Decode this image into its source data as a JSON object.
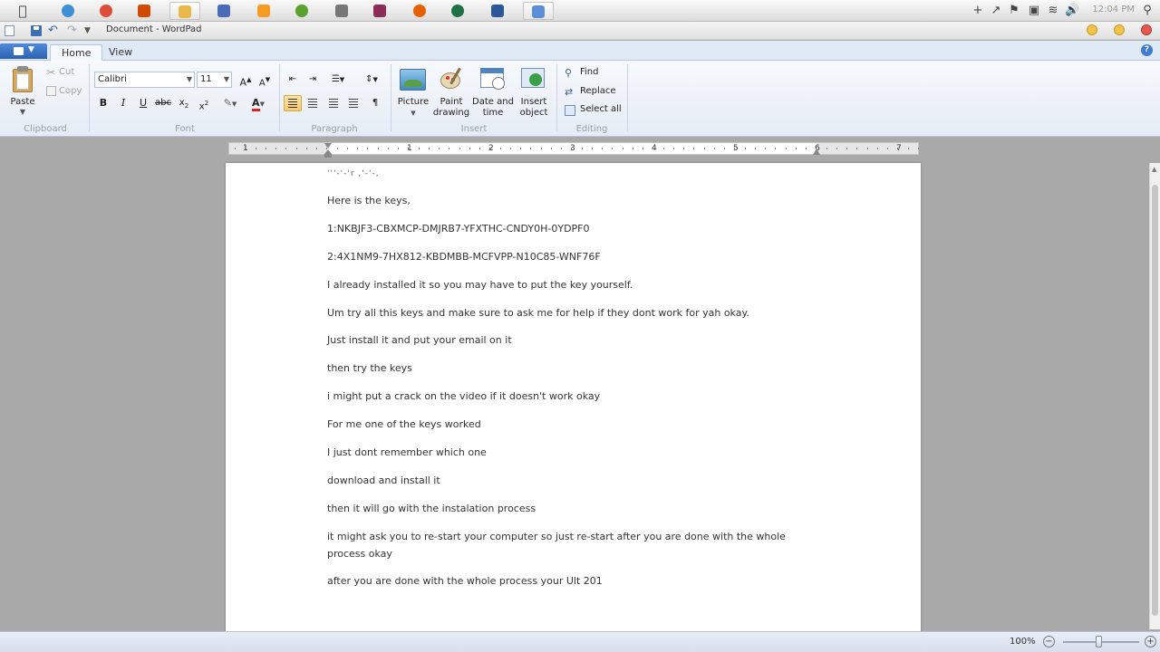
{
  "window": {
    "title": "Document - WordPad"
  },
  "taskbar": {
    "apps": [
      {
        "icon": "ie-icon",
        "color": "#3d8fd6"
      },
      {
        "icon": "chrome-icon",
        "color": "#dd4b39"
      },
      {
        "icon": "office-icon",
        "color": "#d04a02"
      },
      {
        "icon": "folder-icon",
        "color": "#e8b84a"
      },
      {
        "icon": "screen-icon",
        "color": "#4a6cb8"
      },
      {
        "icon": "media-icon",
        "color": "#f59a23"
      },
      {
        "icon": "xbox-icon",
        "color": "#5aa02c"
      },
      {
        "icon": "settings-icon",
        "color": "#777777"
      },
      {
        "icon": "winrar-icon",
        "color": "#8c2b55"
      },
      {
        "icon": "firefox-icon",
        "color": "#e66000"
      },
      {
        "icon": "excel-icon",
        "color": "#1e7145"
      },
      {
        "icon": "word-icon",
        "color": "#2b579a"
      },
      {
        "icon": "wordpad-icon",
        "color": "#5c8fd6"
      }
    ],
    "clock": "12:04 PM"
  },
  "tabs": {
    "home": "Home",
    "view": "View"
  },
  "ribbon": {
    "clipboard": {
      "paste": "Paste",
      "cut": "Cut",
      "copy": "Copy",
      "label": "Clipboard"
    },
    "font": {
      "family": "Calibri",
      "size": "11",
      "label": "Font"
    },
    "paragraph": {
      "label": "Paragraph"
    },
    "insert": {
      "picture": "Picture",
      "paint_drawing": [
        "Paint",
        "drawing"
      ],
      "date_time": [
        "Date and",
        "time"
      ],
      "insert_object": [
        "Insert",
        "object"
      ],
      "label": "Insert"
    },
    "editing": {
      "find": "Find",
      "replace": "Replace",
      "select_all": "Select all",
      "label": "Editing"
    }
  },
  "ruler": {
    "numbers": [
      "1",
      "1",
      "2",
      "3",
      "4",
      "5",
      "6",
      "7"
    ]
  },
  "document": {
    "cut_line": "'''-'-'r ,'-'-,",
    "paragraphs": [
      "Here is the keys,",
      "1:NKBJF3-CBXMCP-DMJRB7-YFXTHC-CNDY0H-0YDPF0",
      "2:4X1NM9-7HX812-KBDMBB-MCFVPP-N10C85-WNF76F",
      "I already installed it so you may have to put the key yourself.",
      "Um try all this keys  and make sure to ask me for help if they dont work for yah okay.",
      "Just install it and put your email on it",
      "then try the keys",
      "i might put a crack on the video if it doesn't work okay",
      "For me one of the keys worked",
      "I just dont remember which one",
      "download and install it",
      "then it will go with the instalation process",
      "it might ask you to re-start your computer so just re-start after you are done with the whole process okay",
      "after you are done with the whole process your Ult 201"
    ]
  },
  "statusbar": {
    "zoom": "100%"
  }
}
